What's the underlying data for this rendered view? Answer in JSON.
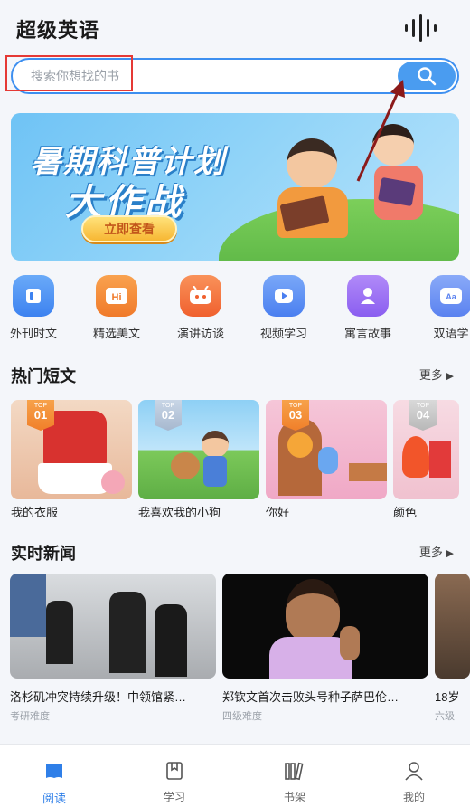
{
  "header": {
    "title": "超级英语",
    "voice_icon": "waveform-icon"
  },
  "search": {
    "placeholder": "搜索你想找的书",
    "button_icon": "search-icon"
  },
  "banner": {
    "title_line1": "暑期科普计划",
    "title_line2": "大作战",
    "button_label": "立即查看"
  },
  "categories": [
    {
      "label": "外刊时文",
      "color": "#4a90f5",
      "icon": "magazine-icon"
    },
    {
      "label": "精选美文",
      "color": "#f5843a",
      "icon": "article-icon"
    },
    {
      "label": "演讲访谈",
      "color": "#f5713a",
      "icon": "speech-icon"
    },
    {
      "label": "视频学习",
      "color": "#5a8ff5",
      "icon": "video-icon"
    },
    {
      "label": "寓言故事",
      "color": "#9a6ff0",
      "icon": "story-icon"
    },
    {
      "label": "双语学",
      "color": "#6a8ff5",
      "icon": "bilingual-icon"
    }
  ],
  "hot_stories": {
    "title": "热门短文",
    "more": "更多",
    "items": [
      {
        "rank_top": "TOP",
        "rank": "01",
        "title": "我的衣服"
      },
      {
        "rank_top": "TOP",
        "rank": "02",
        "title": "我喜欢我的小狗"
      },
      {
        "rank_top": "TOP",
        "rank": "03",
        "title": "你好"
      },
      {
        "rank_top": "TOP",
        "rank": "04",
        "title": "颜色"
      }
    ]
  },
  "news": {
    "title": "实时新闻",
    "more": "更多",
    "items": [
      {
        "title": "洛杉矶冲突持续升级！中领馆紧…",
        "tag": "考研难度"
      },
      {
        "title": "郑钦文首次击败头号种子萨巴伦…",
        "tag": "四级难度"
      },
      {
        "title": "18岁",
        "tag": "六级"
      }
    ]
  },
  "tabbar": [
    {
      "label": "阅读",
      "icon": "book-icon",
      "active": true
    },
    {
      "label": "学习",
      "icon": "bookmark-icon",
      "active": false
    },
    {
      "label": "书架",
      "icon": "bookshelf-icon",
      "active": false
    },
    {
      "label": "我的",
      "icon": "user-icon",
      "active": false
    }
  ],
  "colors": {
    "accent": "#2f7fe8",
    "search_border": "#3d8ff0",
    "highlight": "#e53935"
  }
}
